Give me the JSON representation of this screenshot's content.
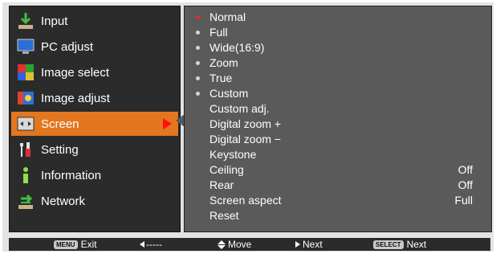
{
  "menu": {
    "items": [
      {
        "label": "Input",
        "icon": "input-icon"
      },
      {
        "label": "PC adjust",
        "icon": "pc-adjust-icon"
      },
      {
        "label": "Image select",
        "icon": "image-select-icon"
      },
      {
        "label": "Image adjust",
        "icon": "image-adjust-icon"
      },
      {
        "label": "Screen",
        "icon": "screen-icon",
        "selected": true
      },
      {
        "label": "Setting",
        "icon": "setting-icon"
      },
      {
        "label": "Information",
        "icon": "information-icon"
      },
      {
        "label": "Network",
        "icon": "network-icon"
      }
    ]
  },
  "screen_menu": {
    "items": [
      {
        "label": "Normal",
        "radio": true,
        "selected": true
      },
      {
        "label": "Full",
        "radio": true
      },
      {
        "label": "Wide(16:9)",
        "radio": true
      },
      {
        "label": "Zoom",
        "radio": true
      },
      {
        "label": "True",
        "radio": true
      },
      {
        "label": "Custom",
        "radio": true
      },
      {
        "label": "Custom adj."
      },
      {
        "label": "Digital zoom +"
      },
      {
        "label": "Digital zoom −"
      },
      {
        "label": "Keystone"
      },
      {
        "label": "Ceiling",
        "value": "Off"
      },
      {
        "label": "Rear",
        "value": "Off"
      },
      {
        "label": "Screen aspect",
        "value": "Full"
      },
      {
        "label": "Reset"
      }
    ]
  },
  "guide": {
    "exit_key": "MENU",
    "exit_label": "Exit",
    "back_label": "-----",
    "move_label": "Move",
    "next_label": "Next",
    "select_key": "SELECT",
    "select_next_label": "Next"
  },
  "colors": {
    "selected_item": "#e3761f",
    "selection_arrow": "#ff1010",
    "radio_on": "#e03030",
    "radio_off": "#d6d6d6"
  }
}
